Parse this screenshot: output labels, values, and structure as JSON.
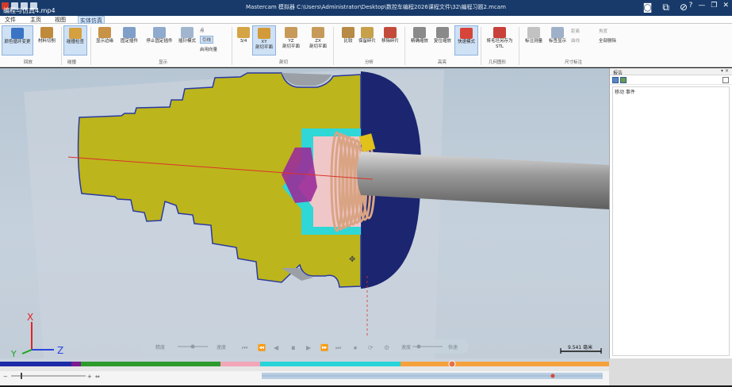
{
  "title_bar": {
    "video_name": "编程与仿真4.mp4",
    "doc_title": "Mastercam 模拟器  C:\\Users\\Administrator\\Desktop\\数控车编程2026课程文件\\32\\编程习题2.mcam"
  },
  "menu": {
    "tabs": [
      "文件",
      "主页",
      "视图",
      "实体仿真"
    ],
    "active_tab": "实体仿真"
  },
  "ribbon": {
    "buttons": [
      {
        "id": "color-cycle",
        "label": "颜色循环变更"
      },
      {
        "id": "material-cut",
        "label": "材料切削"
      },
      {
        "id": "collision",
        "label": "碰撞检查"
      },
      {
        "id": "show-edges",
        "label": "显示边缘"
      },
      {
        "id": "fixed-clamp",
        "label": "固定插件"
      },
      {
        "id": "stop-fixed-clamp",
        "label": "停止固定插件"
      },
      {
        "id": "insert-mode",
        "label": "插针模式"
      },
      {
        "id": "three-quarter",
        "label": "3/4"
      },
      {
        "id": "xy-section",
        "label": "XY\n剖切平面"
      },
      {
        "id": "yz-section",
        "label": "YZ\n剖切平面"
      },
      {
        "id": "zx-section",
        "label": "ZX\n剖切平面"
      },
      {
        "id": "compare",
        "label": "比较"
      },
      {
        "id": "keep-fragments",
        "label": "保留碎片"
      },
      {
        "id": "remove-fragments",
        "label": "移除碎片"
      },
      {
        "id": "precise-zoom",
        "label": "精确缩放"
      },
      {
        "id": "reset-zoom",
        "label": "复位缩放"
      },
      {
        "id": "fast-mode",
        "label": "快速模式"
      },
      {
        "id": "save-stl",
        "label": "将毛坯另存为\nSTL"
      },
      {
        "id": "dim-check",
        "label": "标注测量"
      },
      {
        "id": "label-show",
        "label": "标签显示"
      }
    ],
    "small_items": [
      "点",
      "引线",
      "启用向量",
      "距离",
      "曲线",
      "角度",
      "全部删除"
    ],
    "groups": [
      "回放",
      "碰撞",
      "显示",
      "剖切",
      "分析",
      "高亮",
      "几何图形",
      "尺寸标注"
    ]
  },
  "right_panel": {
    "title": "报告",
    "column_header": "移动 事件"
  },
  "playback": {
    "labels": [
      "精度",
      "速度",
      "速度",
      "快速"
    ],
    "scale_label": "9.541 毫米"
  },
  "axes": {
    "x": "X",
    "y": "Y",
    "z": "Z"
  },
  "colors": {
    "titlebar": "#173a6a",
    "part": "#bdb51c",
    "part_outline": "#2b3aa0",
    "chuck": "#1b2570",
    "cyan": "#2fd7d6",
    "drill": "#9b2c9a",
    "thread": "#d9a484"
  },
  "track_segments": [
    "#1c2aa8",
    "#7a1a8e",
    "#2e9a2e",
    "#f2a6b8",
    "#28d4d8",
    "#f6a23c"
  ]
}
